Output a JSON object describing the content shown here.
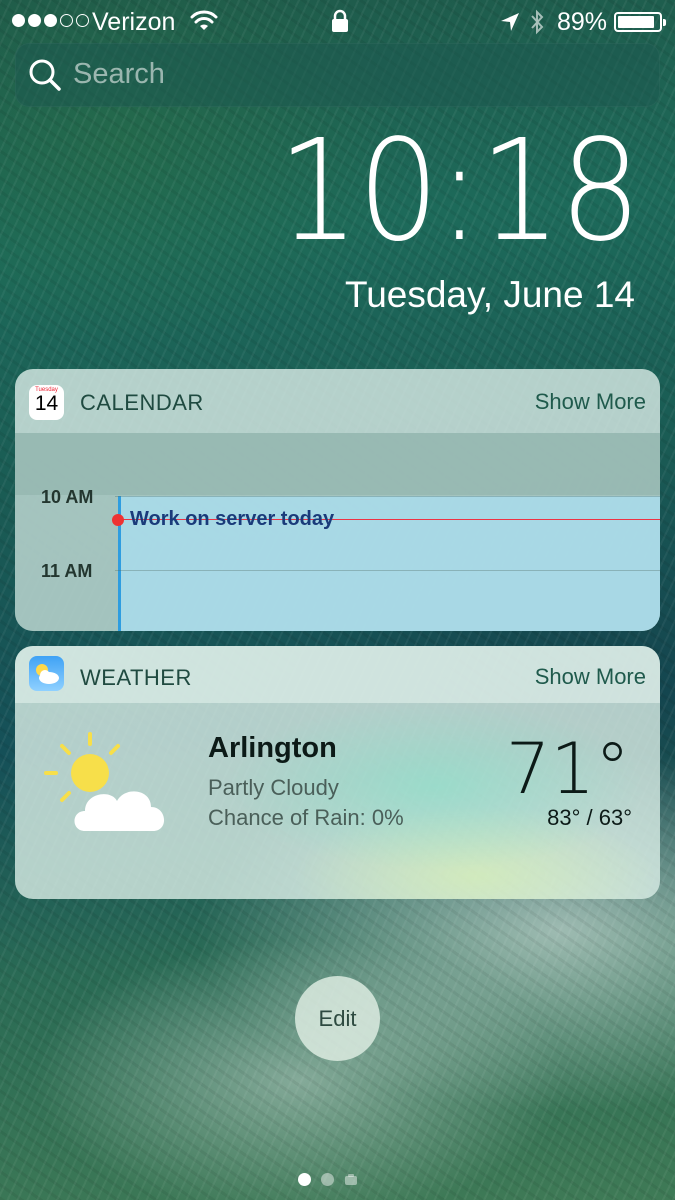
{
  "status_bar": {
    "carrier": "Verizon",
    "battery_percent": "89%",
    "battery_level": 0.89,
    "signal_bars_filled": 3,
    "signal_bars_total": 5,
    "icons": [
      "wifi-icon",
      "lock-icon",
      "location-icon",
      "bluetooth-icon",
      "battery-icon"
    ]
  },
  "search": {
    "placeholder": "Search"
  },
  "lock_screen": {
    "time": "10:18",
    "date": "Tuesday, June 14"
  },
  "calendar_widget": {
    "title": "CALENDAR",
    "show_more": "Show More",
    "icon_day_label": "Tuesday",
    "icon_day_number": "14",
    "hours": [
      "10 AM",
      "11 AM"
    ],
    "event": {
      "title": "Work on server today",
      "color": "#2e9de0"
    },
    "now_indicator_color": "#e33333"
  },
  "weather_widget": {
    "title": "WEATHER",
    "show_more": "Show More",
    "location": "Arlington",
    "condition": "Partly Cloudy",
    "rain": "Chance of Rain: 0%",
    "temperature": "71°",
    "hi_lo": "83° / 63°",
    "icon": "partly-cloudy-icon"
  },
  "edit_button": {
    "label": "Edit"
  },
  "page_indicator": {
    "pages": 3,
    "active_index": 0,
    "last_page_icon": "camera-icon"
  }
}
